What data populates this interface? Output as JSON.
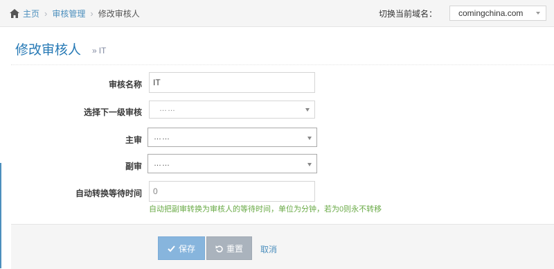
{
  "breadcrumb": {
    "home": "主页",
    "items": [
      "审核管理",
      "修改审核人"
    ],
    "separator": "›"
  },
  "domain": {
    "label": "切换当前域名：",
    "value": "comingchina.com"
  },
  "page": {
    "title": "修改审核人",
    "subtitle_prefix": "»",
    "subtitle": "IT"
  },
  "form": {
    "name": {
      "label": "审核名称",
      "value": "IT"
    },
    "next_level": {
      "label": "选择下一级审核",
      "value": "……"
    },
    "primary": {
      "label": "主审",
      "value": "……"
    },
    "deputy": {
      "label": "副审",
      "value": "……"
    },
    "wait_time": {
      "label": "自动转换等待时间",
      "placeholder": "0",
      "help": "自动把副审转换为审核人的等待时间，单位为分钟，若为0则永不转移"
    }
  },
  "actions": {
    "save": "保存",
    "reset": "重置",
    "cancel": "取消"
  },
  "colors": {
    "accent": "#2679b5",
    "link": "#4c8fbd",
    "help": "#69aa46",
    "save_btn": "#87b5dd",
    "reset_btn": "#aab3bd"
  }
}
